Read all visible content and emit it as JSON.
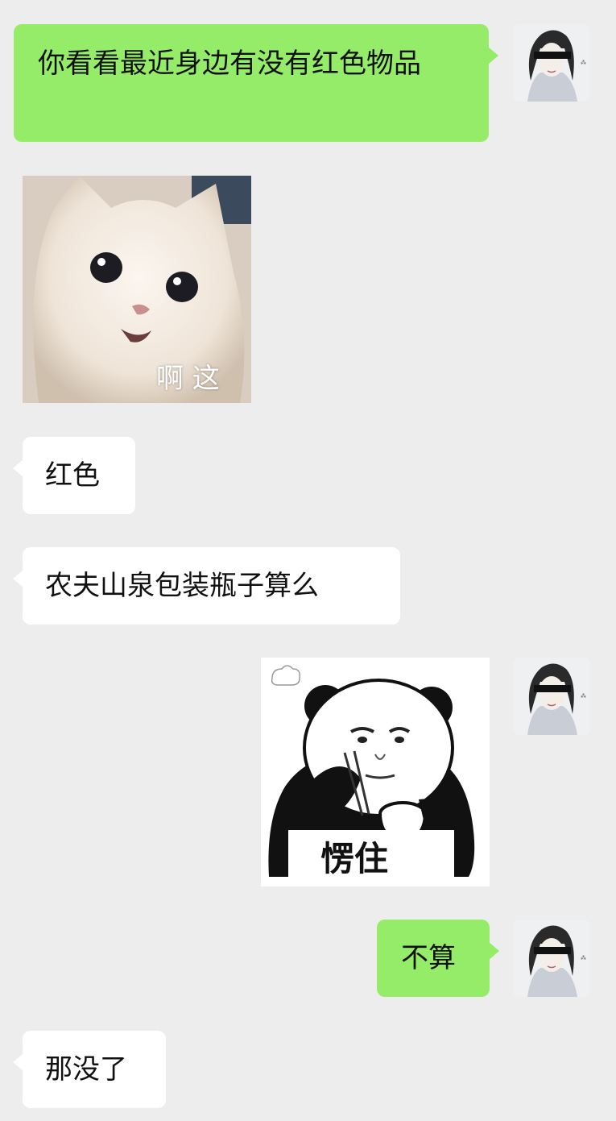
{
  "messages": [
    {
      "sender": "me",
      "type": "text",
      "text": "你看看最近身边有没有红色物品"
    },
    {
      "sender": "other",
      "type": "sticker",
      "sticker": "kitten-face",
      "caption": "啊 这"
    },
    {
      "sender": "other",
      "type": "text",
      "text": "红色"
    },
    {
      "sender": "other",
      "type": "text",
      "text": "农夫山泉包装瓶子算么"
    },
    {
      "sender": "me",
      "type": "sticker",
      "sticker": "panda-eating-meme",
      "caption": "愣住"
    },
    {
      "sender": "me",
      "type": "text",
      "text": "不算"
    },
    {
      "sender": "other",
      "type": "text",
      "text": "那没了"
    }
  ],
  "colors": {
    "background": "#ededed",
    "my_bubble": "#95ec69",
    "other_bubble": "#ffffff"
  }
}
